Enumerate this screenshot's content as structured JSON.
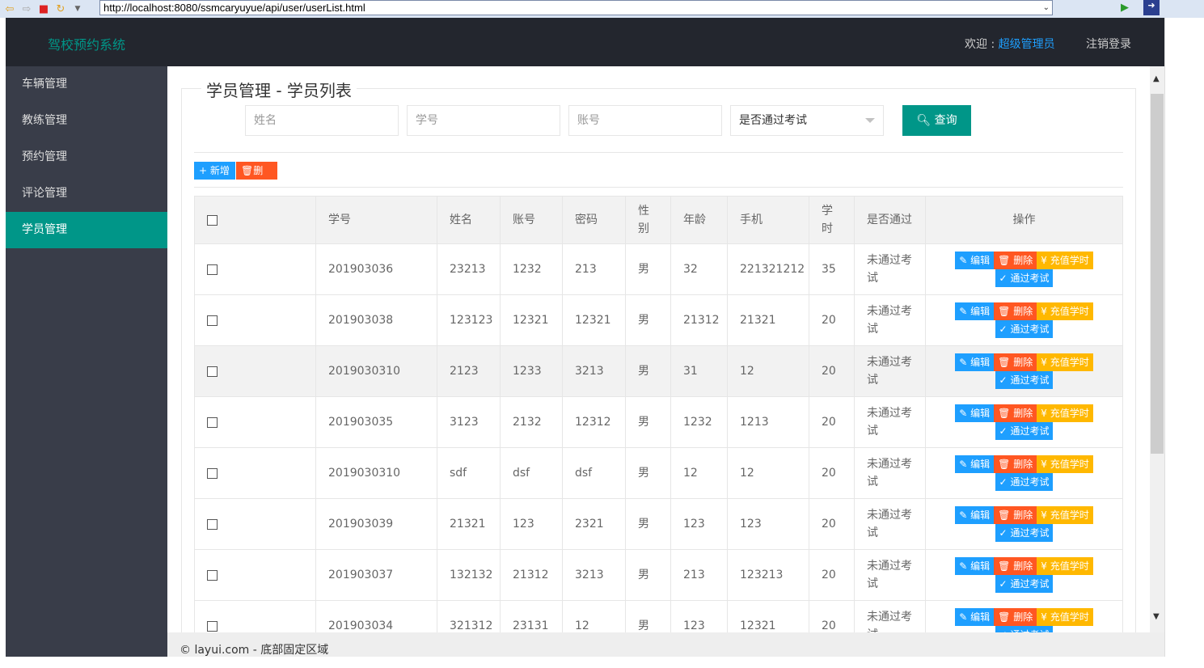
{
  "browser": {
    "url": "http://localhost:8080/ssmcaryuyue/api/user/userList.html"
  },
  "header": {
    "logo": "驾校预约系统",
    "welcome_prefix": "欢迎 : ",
    "user": "超级管理员",
    "logout": "注销登录"
  },
  "sidebar": {
    "items": [
      {
        "label": "车辆管理"
      },
      {
        "label": "教练管理"
      },
      {
        "label": "预约管理"
      },
      {
        "label": "评论管理"
      },
      {
        "label": "学员管理",
        "active": true
      }
    ]
  },
  "main": {
    "title": "学员管理 - 学员列表",
    "search": {
      "name_placeholder": "姓名",
      "number_placeholder": "学号",
      "account_placeholder": "账号",
      "pass_select": "是否通过考试",
      "query_label": "查询"
    },
    "toolbar": {
      "add_label": "新增",
      "delete_label": "删除"
    },
    "table": {
      "headers": [
        "学号",
        "姓名",
        "账号",
        "密码",
        "性别",
        "年龄",
        "手机",
        "学时",
        "是否通过",
        "操作"
      ],
      "row_actions": {
        "edit": "编辑",
        "delete": "删除",
        "recharge": "充值学时",
        "pass": "通过考试"
      },
      "rows": [
        [
          "201903036",
          "23213",
          "1232",
          "213",
          "男",
          "32",
          "221321212",
          "35",
          "未通过考试"
        ],
        [
          "201903038",
          "123123",
          "12321",
          "12321",
          "男",
          "21312",
          "21321",
          "20",
          "未通过考试"
        ],
        [
          "2019030310",
          "2123",
          "1233",
          "3213",
          "男",
          "31",
          "12",
          "20",
          "未通过考试"
        ],
        [
          "201903035",
          "3123",
          "2132",
          "12312",
          "男",
          "1232",
          "1213",
          "20",
          "未通过考试"
        ],
        [
          "2019030310",
          "sdf",
          "dsf",
          "dsf",
          "男",
          "12",
          "12",
          "20",
          "未通过考试"
        ],
        [
          "201903039",
          "21321",
          "123",
          "2321",
          "男",
          "123",
          "123",
          "20",
          "未通过考试"
        ],
        [
          "201903037",
          "132132",
          "21312",
          "3213",
          "男",
          "213",
          "123213",
          "20",
          "未通过考试"
        ],
        [
          "201903034",
          "321312",
          "23131",
          "12",
          "男",
          "123",
          "12321",
          "20",
          "未通过考试"
        ]
      ]
    }
  },
  "footer": {
    "text": "© layui.com - 底部固定区域"
  }
}
